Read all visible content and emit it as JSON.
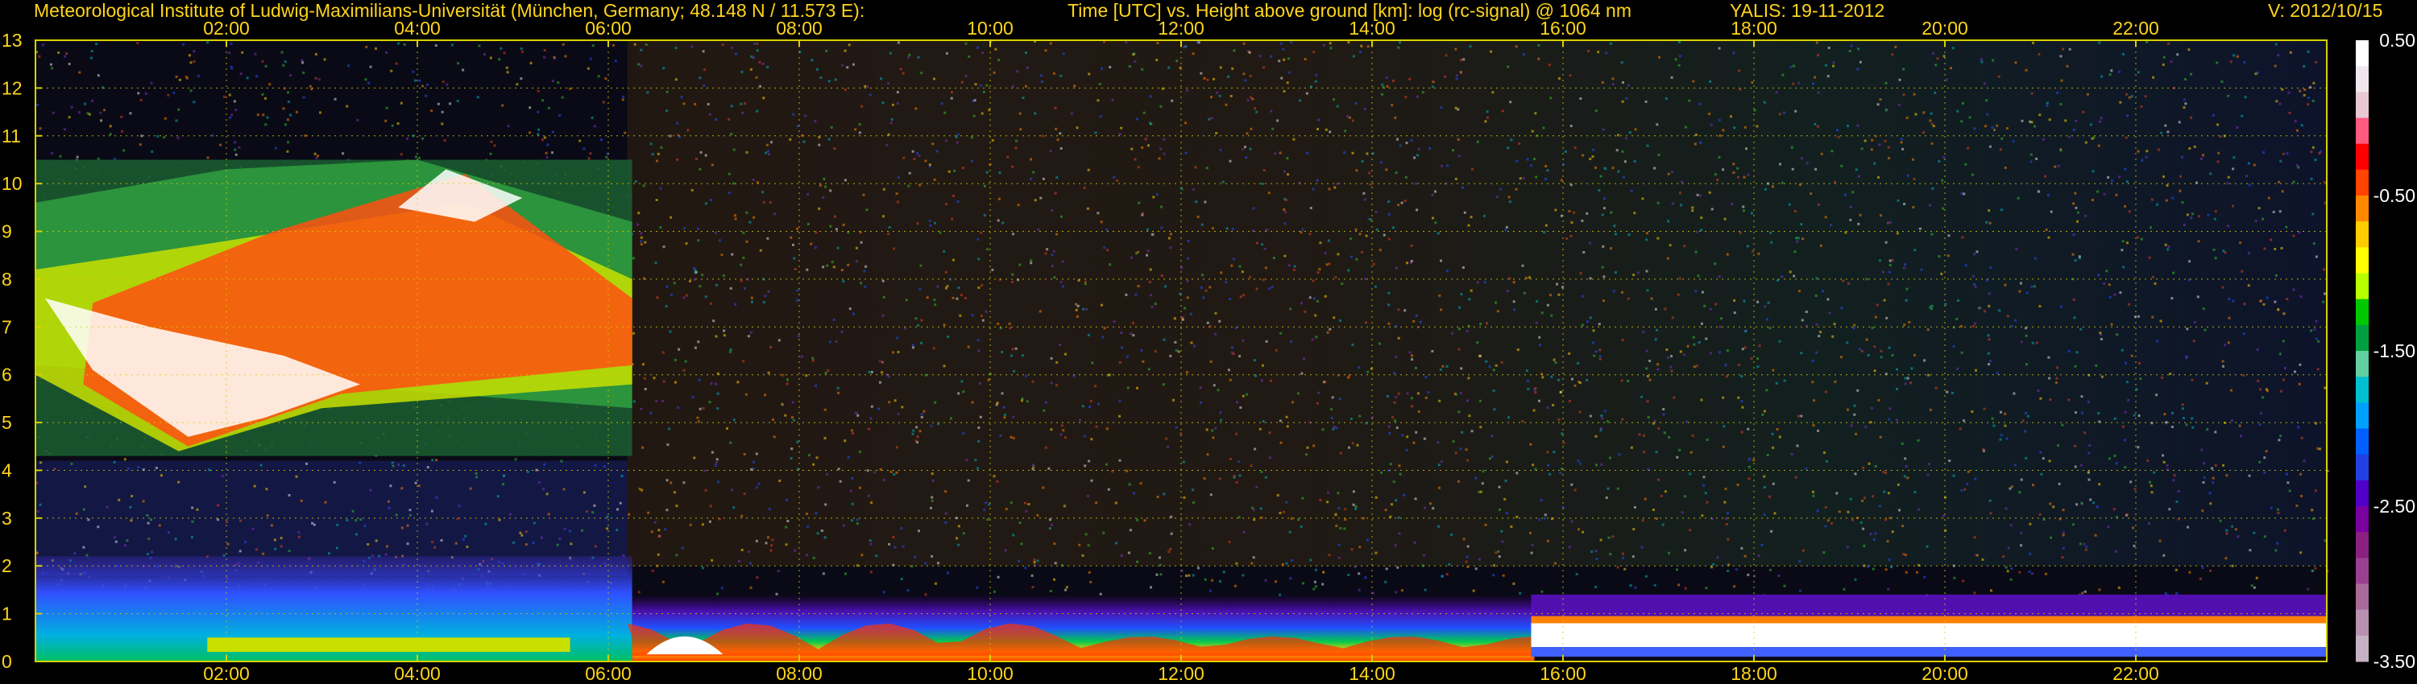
{
  "header": {
    "institute": "Meteorological Institute of Ludwig-Maximilians-Universität (München, Germany; 48.148 N / 11.573 E):",
    "axes_title": "Time [UTC] vs. Height above ground [km]: log (rc-signal) @ 1064 nm",
    "station_date": "YALIS: 19-11-2012",
    "version": "V: 2012/10/15"
  },
  "colors": {
    "text": "#ffd51a",
    "grid": "#d8d000",
    "background": "#000000"
  },
  "chart_data": {
    "type": "heatmap",
    "title": "Time [UTC] vs. Height above ground [km]: log (rc-signal) @ 1064 nm",
    "xlabel": "Time [UTC]",
    "ylabel": "Height above ground [km]",
    "x_ticks": [
      "02:00",
      "04:00",
      "06:00",
      "08:00",
      "10:00",
      "12:00",
      "14:00",
      "16:00",
      "18:00",
      "20:00",
      "22:00"
    ],
    "x_range_hours": [
      0,
      24
    ],
    "y_ticks": [
      0,
      1,
      2,
      3,
      4,
      5,
      6,
      7,
      8,
      9,
      10,
      11,
      12,
      13
    ],
    "y_range_km": [
      0,
      13
    ],
    "grid": true,
    "colorbar": {
      "ticks": [
        "0.50",
        "-0.50",
        "-1.50",
        "-2.50",
        "-3.50"
      ],
      "range": [
        -3.5,
        0.5
      ],
      "colors": [
        "#ffffff",
        "#f0e6ee",
        "#e8c8d2",
        "#ff5a80",
        "#ff0000",
        "#ff4400",
        "#ff8800",
        "#ffcc00",
        "#ffff00",
        "#b8ff00",
        "#00c800",
        "#00a040",
        "#60d0a0",
        "#00c0d0",
        "#00a0ff",
        "#0060ff",
        "#2040e0",
        "#5000c8",
        "#7a00a0",
        "#8a2080",
        "#9a4090",
        "#a86a9a",
        "#b890b0",
        "#c6b0c4"
      ]
    },
    "features": [
      {
        "name": "high cloud",
        "time_range": [
          "00:00",
          "06:15"
        ],
        "height_km": [
          4.3,
          10.5
        ]
      },
      {
        "name": "boundary layer",
        "time_range": [
          "00:00",
          "24:00"
        ],
        "height_km": [
          0,
          1.5
        ]
      },
      {
        "name": "dense low layer",
        "time_range": [
          "15:40",
          "24:00"
        ],
        "height_km": [
          0.3,
          0.8
        ]
      }
    ]
  }
}
